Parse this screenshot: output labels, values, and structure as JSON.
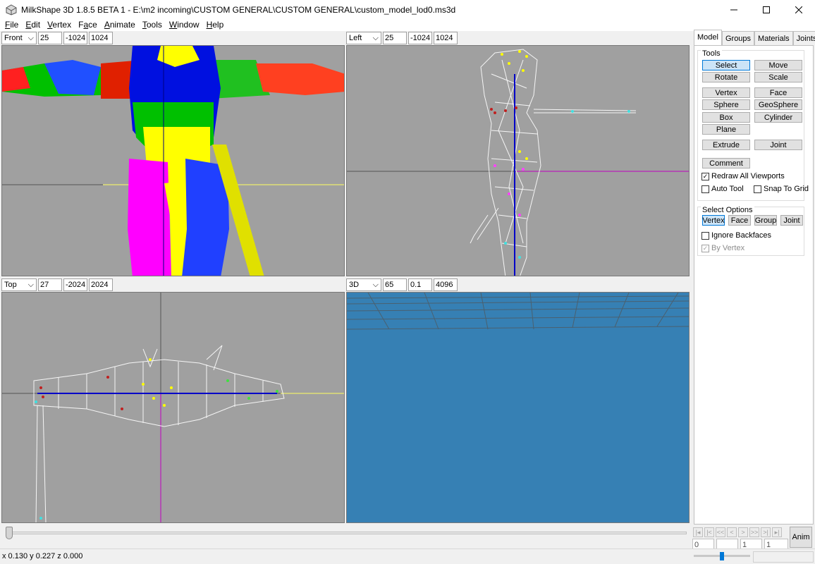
{
  "window": {
    "title": "MilkShape 3D 1.8.5 BETA 1 - E:\\m2 incoming\\CUSTOM GENERAL\\CUSTOM GENERAL\\custom_model_lod0.ms3d"
  },
  "menu": [
    {
      "label": "File",
      "key": "F",
      "rest": "ile"
    },
    {
      "label": "Edit",
      "key": "E",
      "rest": "dit"
    },
    {
      "label": "Vertex",
      "key": "V",
      "rest": "ertex"
    },
    {
      "label": "Face",
      "key": "F",
      "rest": "ace"
    },
    {
      "label": "Animate",
      "key": "A",
      "rest": "nimate"
    },
    {
      "label": "Tools",
      "key": "T",
      "rest": "ools"
    },
    {
      "label": "Window",
      "key": "W",
      "rest": "indow"
    },
    {
      "label": "Help",
      "key": "H",
      "rest": "elp"
    }
  ],
  "viewports": {
    "front": {
      "view": "Front",
      "v1": "25",
      "v2": "-1024",
      "v3": "1024"
    },
    "left": {
      "view": "Left",
      "v1": "25",
      "v2": "-1024",
      "v3": "1024"
    },
    "top": {
      "view": "Top",
      "v1": "27",
      "v2": "-2024",
      "v3": "2024"
    },
    "threed": {
      "view": "3D",
      "v1": "65",
      "v2": "0.1",
      "v3": "4096"
    }
  },
  "panel": {
    "tabs": [
      "Model",
      "Groups",
      "Materials",
      "Joints"
    ],
    "active_tab": "Model",
    "tools_title": "Tools",
    "tools": {
      "select": "Select",
      "move": "Move",
      "rotate": "Rotate",
      "scale": "Scale",
      "vertex": "Vertex",
      "face": "Face",
      "sphere": "Sphere",
      "geosphere": "GeoSphere",
      "box": "Box",
      "cylinder": "Cylinder",
      "plane": "Plane",
      "extrude": "Extrude",
      "joint": "Joint",
      "comment": "Comment"
    },
    "redraw_all": {
      "label": "Redraw All Viewports",
      "checked": true
    },
    "auto_tool": {
      "label": "Auto Tool",
      "checked": false
    },
    "snap_grid": {
      "label": "Snap To Grid",
      "checked": false
    },
    "select_options_title": "Select Options",
    "select_options": {
      "vertex": "Vertex",
      "face": "Face",
      "group": "Group",
      "joint": "Joint"
    },
    "ignore_backfaces": {
      "label": "Ignore Backfaces",
      "checked": false
    },
    "by_vertex": {
      "label": "By Vertex",
      "checked": true
    }
  },
  "animation": {
    "frame_current": "0",
    "frame_start": "1",
    "frame_end": "1",
    "anim_label": "Anim"
  },
  "status": {
    "coords": "x 0.130 y 0.227 z 0.000"
  },
  "colors": {
    "viewport_bg": "#a0a0a0",
    "threed_bg": "#3680b4",
    "mesh_lines": "#ffffff",
    "joint_line": "#0000c8"
  }
}
